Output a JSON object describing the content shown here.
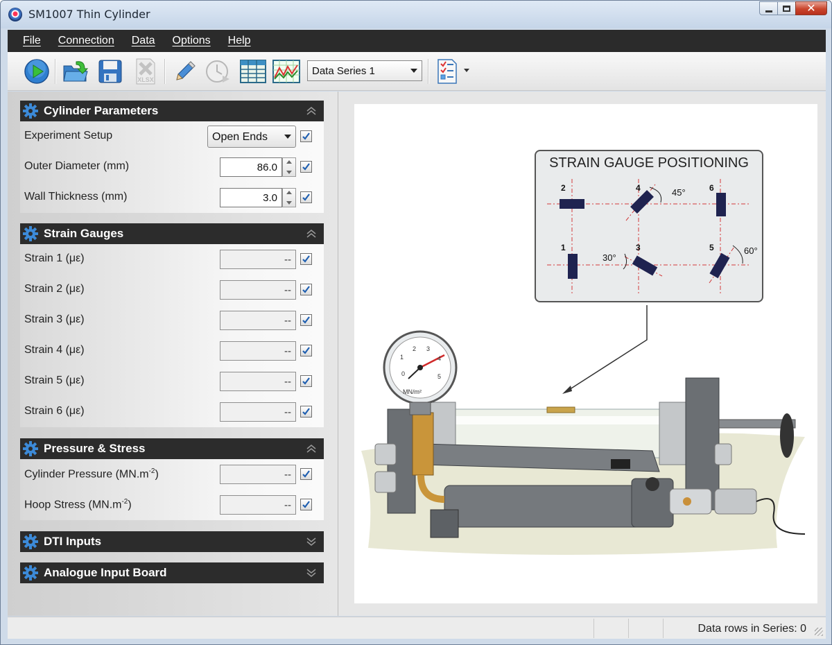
{
  "window": {
    "title": "SM1007 Thin Cylinder",
    "buttons": [
      "minimize",
      "maximize",
      "close"
    ]
  },
  "menu": [
    {
      "label": "File"
    },
    {
      "label": "Connection"
    },
    {
      "label": "Data"
    },
    {
      "label": "Options"
    },
    {
      "label": "Help"
    }
  ],
  "toolbar": {
    "buttons": [
      "play-icon",
      "open-folder-icon",
      "save-icon",
      "export-xlsx-icon",
      "pencil-icon",
      "clock-icon",
      "table-icon",
      "chart-icon",
      "checklist-icon"
    ],
    "xlsx_label": "XLSX",
    "series_select": "Data Series 1"
  },
  "sections": {
    "cylinder": {
      "title": "Cylinder Parameters",
      "experiment_label": "Experiment Setup",
      "experiment_value": "Open Ends",
      "outer_label": "Outer Diameter  (mm)",
      "outer_value": "86.0",
      "wall_label": "Wall Thickness  (mm)",
      "wall_value": "3.0"
    },
    "strain": {
      "title": "Strain Gauges",
      "rows": [
        {
          "label": "Strain 1  (με)",
          "value": "--"
        },
        {
          "label": "Strain 2  (με)",
          "value": "--"
        },
        {
          "label": "Strain 3  (με)",
          "value": "--"
        },
        {
          "label": "Strain 4  (με)",
          "value": "--"
        },
        {
          "label": "Strain 5  (με)",
          "value": "--"
        },
        {
          "label": "Strain 6  (με)",
          "value": "--"
        }
      ]
    },
    "pressure": {
      "title": "Pressure & Stress",
      "pressure_label": "Cylinder Pressure  (MN.m",
      "pressure_value": "--",
      "hoop_label": "Hoop Stress  (MN.m",
      "hoop_value": "--",
      "unit_exponent": "-2",
      "unit_close": ")"
    },
    "dti": {
      "title": "DTI Inputs"
    },
    "analogue": {
      "title": "Analogue Input Board"
    }
  },
  "diagram": {
    "title": "STRAIN GAUGE POSITIONING",
    "gauge_numbers": [
      "1",
      "2",
      "3",
      "4",
      "5",
      "6"
    ],
    "angles": [
      "45°",
      "30°",
      "60°"
    ],
    "gauge_dial_unit": "MN/m²",
    "gauge_dial_ticks": [
      "0",
      "1",
      "2",
      "3",
      "4",
      "5"
    ]
  },
  "status": {
    "text": "Data rows in Series: 0"
  },
  "colors": {
    "menubar": "#2b2b2b",
    "section_header": "#2c2c2c",
    "accent_blue": "#2f6fbf",
    "gauge_block": "#1f2350",
    "dash_red": "#d23a3a"
  }
}
